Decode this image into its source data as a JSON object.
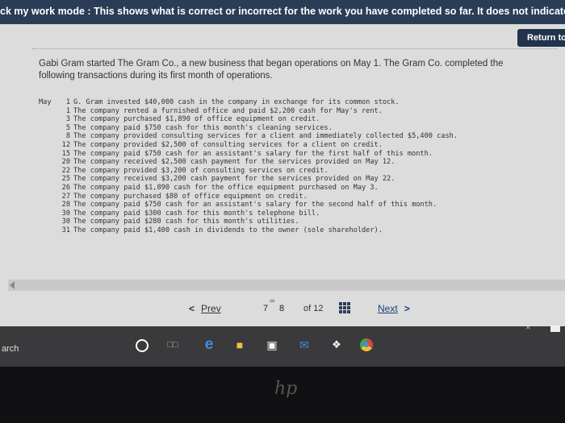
{
  "topbar": {
    "message": "ck my work mode : This shows what is correct or incorrect for the work you have completed so far. It does not indicate completi"
  },
  "return_button": {
    "label": "Return to"
  },
  "problem": {
    "intro": "Gabi Gram started The Gram Co., a new business that began operations on May 1. The Gram Co. completed the following transactions during its first month of operations.",
    "month": "May",
    "transactions": [
      {
        "day": "1",
        "text": "G. Gram invested $40,000 cash in the company in exchange for its common stock."
      },
      {
        "day": "1",
        "text": "The company rented a furnished office and paid $2,200 cash for May's rent."
      },
      {
        "day": "3",
        "text": "The company purchased $1,890 of office equipment on credit."
      },
      {
        "day": "5",
        "text": "The company paid $750 cash for this month's cleaning services."
      },
      {
        "day": "8",
        "text": "The company provided consulting services for a client and immediately collected $5,400 cash."
      },
      {
        "day": "12",
        "text": "The company provided $2,500 of consulting services for a client on credit."
      },
      {
        "day": "15",
        "text": "The company paid $750 cash for an assistant's salary for the first half of this month."
      },
      {
        "day": "20",
        "text": "The company received $2,500 cash payment for the services provided on May 12."
      },
      {
        "day": "22",
        "text": "The company provided $3,200 of consulting services on credit."
      },
      {
        "day": "25",
        "text": "The company received $3,200 cash payment for the services provided on May 22."
      },
      {
        "day": "26",
        "text": "The company paid $1,890 cash for the office equipment purchased on May 3."
      },
      {
        "day": "27",
        "text": "The company purchased $80 of office equipment on credit."
      },
      {
        "day": "28",
        "text": "The company paid $750 cash for an assistant's salary for the second half of this month."
      },
      {
        "day": "30",
        "text": "The company paid $300 cash for this month's telephone bill."
      },
      {
        "day": "30",
        "text": "The company paid $280 cash for this month's utilities."
      },
      {
        "day": "31",
        "text": "The company paid $1,400 cash in dividends to the owner (sole shareholder)."
      }
    ]
  },
  "pager": {
    "prev_label": "Prev",
    "current_page": "7",
    "next_page": "8",
    "of_total": "of 12",
    "next_label": "Next"
  },
  "taskbar": {
    "search_label": "arch",
    "icons": [
      "cortana-icon",
      "task-view-icon",
      "edge-icon",
      "file-explorer-icon",
      "store-icon",
      "mail-icon",
      "dropbox-icon",
      "chrome-icon"
    ]
  },
  "bezel": {
    "logo": "hp"
  },
  "colors": {
    "header": "#2b3d56",
    "button": "#22334d",
    "link": "#1b3f78"
  }
}
